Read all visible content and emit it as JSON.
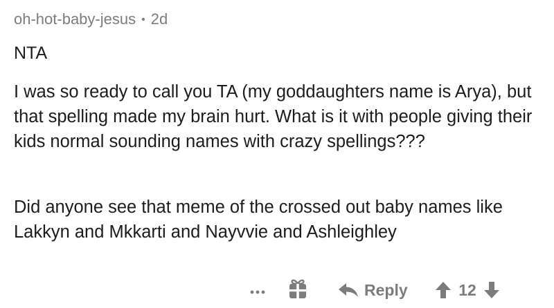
{
  "comment": {
    "author": "oh-hot-baby-jesus",
    "separator": "•",
    "age": "2d",
    "verdict": "NTA",
    "paragraphs": [
      "I was so ready to call you TA (my goddaughters name is Arya), but that spelling made my brain hurt. What is it with people giving their kids normal sounding names with crazy spellings???",
      "Did anyone see that meme of the crossed out baby names like Lakkyn and Mkkarti and Nayvvie and Ashleighley"
    ]
  },
  "actions": {
    "more_icon": "ellipsis-icon",
    "award_icon": "gift-icon",
    "reply_icon": "reply-arrow-icon",
    "reply_label": "Reply",
    "upvote_icon": "upvote-arrow-icon",
    "score": "12",
    "downvote_icon": "downvote-arrow-icon"
  },
  "colors": {
    "text": "#1c1c1c",
    "muted": "#7c7c7c",
    "background": "#ffffff"
  }
}
